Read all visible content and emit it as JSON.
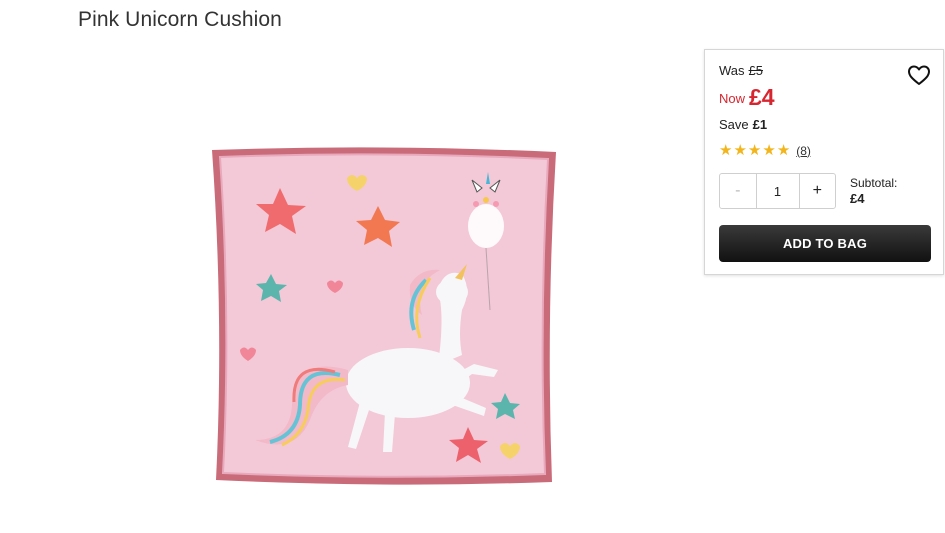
{
  "product": {
    "title": "Pink Unicorn Cushion",
    "image_alt": "pink unicorn cushion product photo"
  },
  "pricing": {
    "was_label": "Was",
    "was_price": "£5",
    "now_label": "Now",
    "now_price": "£4",
    "save_label": "Save",
    "save_amount": "£1"
  },
  "rating": {
    "stars": 5,
    "max_stars": 5,
    "count_text": "(8)",
    "star_color": "#f2b51c"
  },
  "quantity": {
    "minus_label": "-",
    "value": "1",
    "plus_label": "+"
  },
  "subtotal": {
    "label": "Subtotal:",
    "value": "£4"
  },
  "actions": {
    "add_to_bag_label": "ADD TO BAG",
    "wishlist_icon": "heart-outline-icon"
  },
  "colors": {
    "sale_red": "#d7262f",
    "button_dark": "#1a1a1a"
  }
}
